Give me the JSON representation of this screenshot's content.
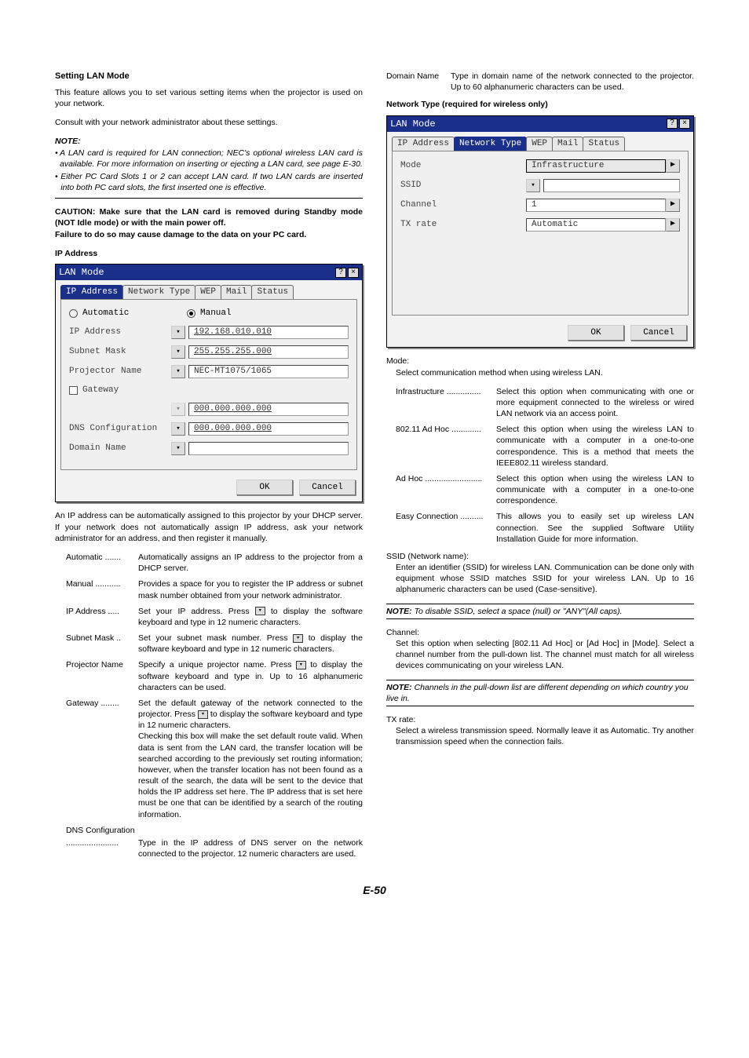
{
  "left": {
    "heading": "Setting LAN Mode",
    "intro1": "This feature allows you to set various setting items when the projector is used on your network.",
    "intro2": "Consult with your network administrator about these settings.",
    "noteLabel": "NOTE:",
    "noteBullet1": "A LAN card is required for LAN connection; NEC's optional wireless LAN card is available. For more information on inserting or ejecting a LAN card, see page E-30.",
    "noteBullet2": "Either PC Card Slots 1 or 2 can accept LAN card. If two LAN cards are inserted into both PC card slots, the first inserted one is effective.",
    "caution": "CAUTION: Make sure that the LAN card is removed during Standby mode (NOT Idle mode) or with the main power off.\nFailure to do so may cause damage to the data on your PC card.",
    "ipHeading": "IP Address",
    "dialog1": {
      "title": "LAN Mode",
      "tabs": [
        "IP Address",
        "Network Type",
        "WEP",
        "Mail",
        "Status"
      ],
      "radioAuto": "Automatic",
      "radioManual": "Manual",
      "rowIp": "IP Address",
      "valIp": "192.168.010.010",
      "rowMask": "Subnet Mask",
      "valMask": "255.255.255.000",
      "rowProj": "Projector Name",
      "valProj": "NEC-MT1075/1065",
      "rowGateway": "Gateway",
      "valGw": "000.000.000.000",
      "rowDns": "DNS Configuration",
      "valDns": "000.000.000.000",
      "rowDomain": "Domain Name",
      "ok": "OK",
      "cancel": "Cancel"
    },
    "ipPara": "An IP address can be automatically assigned to this projector by your DHCP server. If your network does not automatically assign IP address, ask your network administrator for an address, and then register it manually.",
    "def": {
      "autoT": "Automatic .......",
      "autoD": "Automatically assigns an IP address to the projector from a DHCP server.",
      "manualT": "Manual ...........",
      "manualD": "Provides a space for you to register the IP address or subnet mask number obtained from your network administrator.",
      "ipT": "IP Address .....",
      "ipD1": "Set your IP address. Press ",
      "ipD2": " to display the software keyboard and type in 12 numeric characters.",
      "maskT": "Subnet Mask ..",
      "maskD1": "Set your subnet mask number. Press ",
      "maskD2": " to display the software keyboard and type in 12 numeric characters.",
      "projT": "Projector Name",
      "projD1": "Specify a unique projector name. Press ",
      "projD2": " to display the software keyboard and type in. Up to 16 alphanumeric characters can be used.",
      "gwT": "Gateway ........",
      "gwD1": "Set the default gateway of the network connected to the projector. Press ",
      "gwD2": " to display the software keyboard and type in 12 numeric characters.\nChecking this box will make the set default route valid. When data is sent from the LAN card, the transfer location will be searched according to the previously set routing information; however, when the transfer location has not been found as a result of the search, the data will be sent to the device that holds the IP address set here. The IP address that is set here must be one that can be identified by a search of the routing information.",
      "dnsHead": "DNS Configuration",
      "dnsT": ".......................",
      "dnsD": "Type in the IP address of DNS server on the network connected to the projector. 12 numeric characters are used."
    }
  },
  "right": {
    "domainT": "Domain Name",
    "domainD": "Type in domain name of the network connected to the projector. Up to 60 alphanumeric characters can be used.",
    "netTypeHeading": "Network Type (required for wireless only)",
    "dialog2": {
      "title": "LAN Mode",
      "tabs": [
        "IP Address",
        "Network Type",
        "WEP",
        "Mail",
        "Status"
      ],
      "rowMode": "Mode",
      "valMode": "Infrastructure",
      "rowSsid": "SSID",
      "rowChannel": "Channel",
      "valChannel": "1",
      "rowTx": "TX rate",
      "valTx": "Automatic",
      "ok": "OK",
      "cancel": "Cancel"
    },
    "modeHead": "Mode:",
    "modeDesc": "Select communication method when using wireless LAN.",
    "def": {
      "infraT": "Infrastructure ...............",
      "infraD": "Select this option when communicating with one or more equipment connected to the wireless or wired LAN network via an access point.",
      "adhoc802T": "802.11 Ad Hoc .............",
      "adhoc802D": "Select this option when using the wireless LAN to communicate with a computer in a one-to-one correspondence. This is a method that meets the IEEE802.11 wireless standard.",
      "adhocT": "Ad Hoc .........................",
      "adhocD": "Select this option when using the wireless LAN to communicate with a computer in a one-to-one correspondence.",
      "easyT": "Easy Connection ..........",
      "easyD": "This allows you to easily set up wireless LAN connection. See the supplied Software Utility Installation Guide for more information."
    },
    "ssidHead": "SSID (Network name):",
    "ssidDesc": "Enter an identifier (SSID) for wireless LAN. Communication can be done only with equipment whose SSID matches SSID for your wireless LAN. Up to 16 alphanumeric characters can be used (Case-sensitive).",
    "ssidNote": " To disable SSID, select a space (null) or \"ANY\"(All caps).",
    "chanHead": "Channel:",
    "chanDesc": "Set this option when selecting [802.11 Ad Hoc] or [Ad Hoc] in [Mode]. Select a channel number from the pull-down list. The channel must match for all wireless devices communicating on your wireless LAN.",
    "chanNote": " Channels in the pull-down list are different depending on which country you live in.",
    "txHead": "TX rate:",
    "txDesc": "Select a wireless transmission speed. Normally leave it as Automatic. Try another transmission speed when the connection fails."
  },
  "noteWord": "NOTE:",
  "pageNum": "E-50"
}
